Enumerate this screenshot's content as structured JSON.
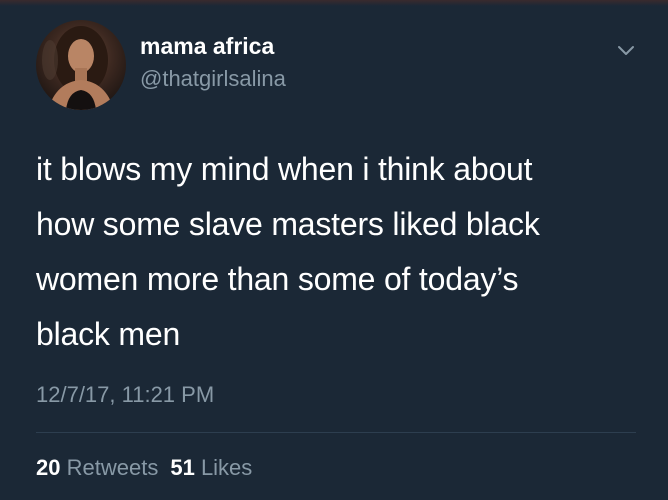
{
  "tweet": {
    "display_name": "mama africa",
    "handle": "@thatgirlsalina",
    "text_lines": [
      "it blows my mind when i think about",
      "how some slave masters liked black",
      "women more than some of today’s",
      "black men"
    ],
    "timestamp": "12/7/17, 11:21 PM",
    "retweets": {
      "count": "20",
      "label": "Retweets"
    },
    "likes": {
      "count": "51",
      "label": "Likes"
    }
  },
  "icons": {
    "menu": "chevron-down-icon"
  },
  "colors": {
    "background": "#1b2836",
    "text_primary": "#ffffff",
    "text_secondary": "#8899a6"
  }
}
